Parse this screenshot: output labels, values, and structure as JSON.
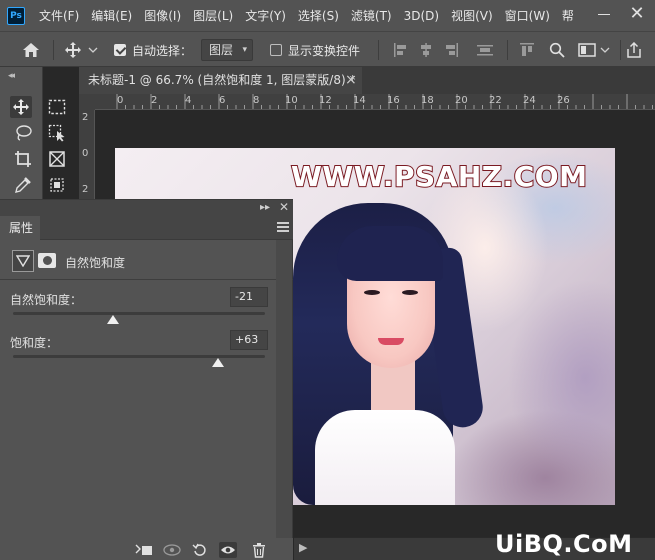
{
  "app": {
    "logo": "Ps"
  },
  "menu": [
    "文件(F)",
    "编辑(E)",
    "图像(I)",
    "图层(L)",
    "文字(Y)",
    "选择(S)",
    "滤镜(T)",
    "3D(D)",
    "视图(V)",
    "窗口(W)",
    "帮"
  ],
  "window": {
    "close_glyph": "✕"
  },
  "options": {
    "auto_select_label": "自动选择：",
    "auto_select_checked": true,
    "auto_select_target": "图层",
    "show_transform_label": "显示变换控件",
    "show_transform_checked": false
  },
  "document": {
    "tab_title": "未标题-1 @ 66.7% (自然饱和度 1, 图层蒙版/8) *",
    "close_glyph": "×",
    "image_watermark": "WWW.PSAHZ.COM"
  },
  "ruler": {
    "top_ticks": [
      "0",
      "2",
      "4",
      "6",
      "8",
      "10",
      "12",
      "14",
      "16",
      "18",
      "20",
      "22",
      "24",
      "26"
    ],
    "left_ticks": [
      "2",
      "0",
      "2"
    ]
  },
  "properties": {
    "tab_label": "属性",
    "adjustment_title": "自然饱和度",
    "sliders": [
      {
        "label": "自然饱和度：",
        "value": "-21",
        "level": -21,
        "min": -100,
        "max": 100
      },
      {
        "label": "饱和度：",
        "value": "+63",
        "level": 63,
        "min": -100,
        "max": 100
      }
    ]
  },
  "site_watermark": "UiBQ.CoM",
  "colors": {
    "accent": "#31a8ff",
    "watermark_stroke": "#7a1a22"
  }
}
